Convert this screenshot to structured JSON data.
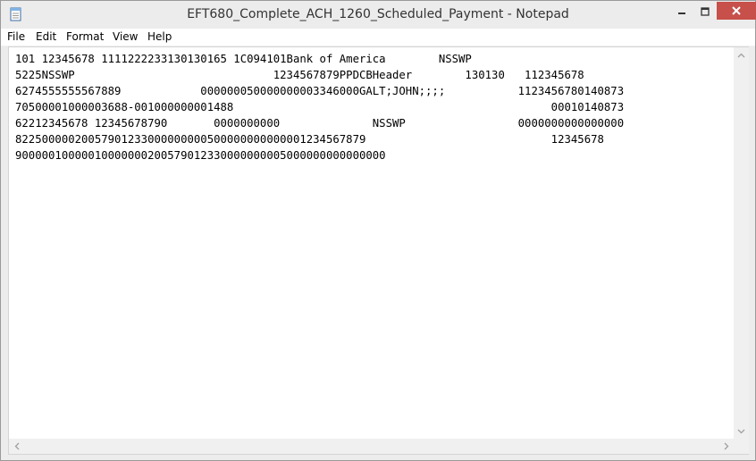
{
  "window": {
    "title": "EFT680_Complete_ACH_1260_Scheduled_Payment - Notepad",
    "app_icon": "notepad-icon",
    "controls": [
      "minimize-icon",
      "maximize-icon",
      "close-icon"
    ]
  },
  "menu": {
    "items": [
      {
        "label": "File"
      },
      {
        "label": "Edit"
      },
      {
        "label": "Format"
      },
      {
        "label": "View"
      },
      {
        "label": "Help"
      }
    ]
  },
  "editor": {
    "lines": [
      "101 12345678 1111222233130130165 1C094101Bank of America        NSSWP",
      "5225NSSWP                              1234567879PPDCBHeader        130130   112345678",
      "6274555555567889            000000050000000003346000GALT;JOHN;;;;           1123456780140873",
      "70500001000003688-001000000001488                                                00010140873",
      "62212345678 12345678790       0000000000              NSSWP                 0000000000000000",
      "82250000020057901233000000000500000000000001234567879                            12345678",
      "90000010000010000000200579012330000000005000000000000000"
    ]
  },
  "colors": {
    "title_bar": "#ececec",
    "close_button": "#c7504a",
    "text": "#000000",
    "scrollbar": "#f0f0f0"
  }
}
